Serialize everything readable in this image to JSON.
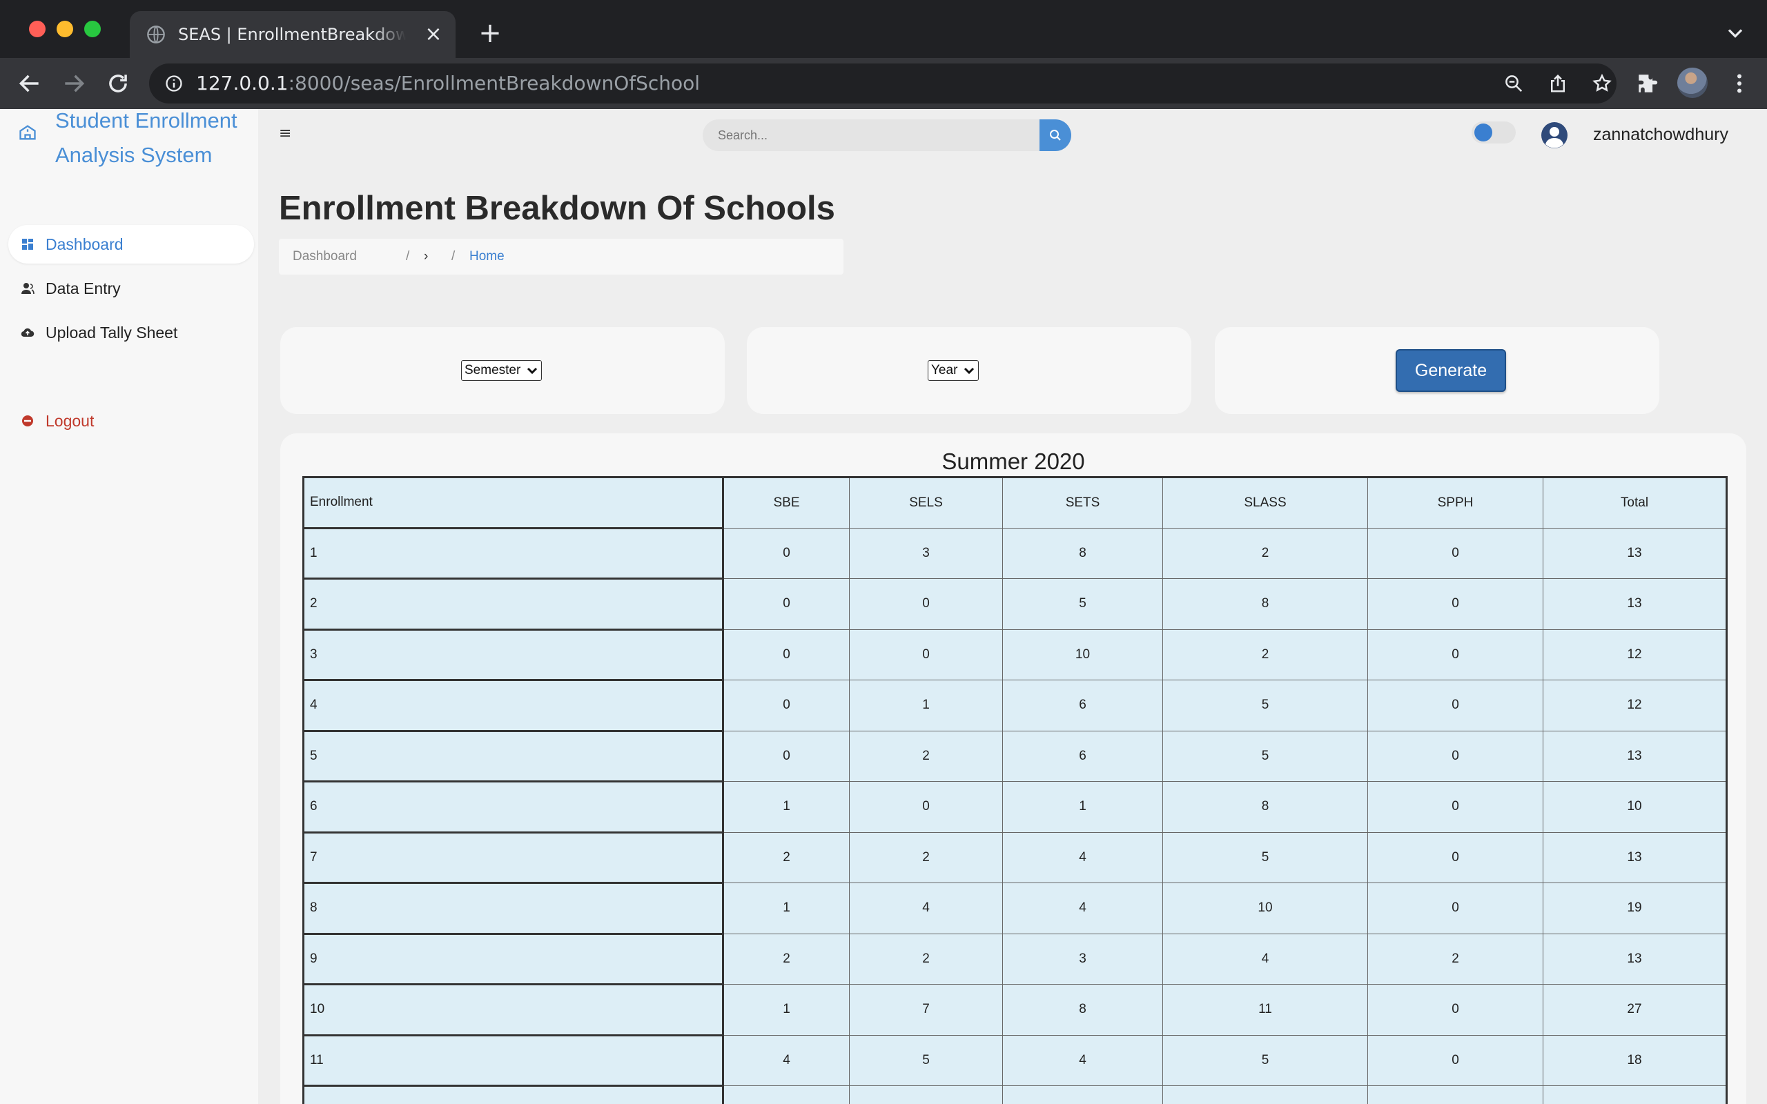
{
  "browser": {
    "tab_title": "SEAS | EnrollmentBreakdownOfSchool",
    "url_host": "127.0.0.1",
    "url_rest": ":8000/seas/EnrollmentBreakdownOfSchool"
  },
  "sidebar": {
    "brand": "Student Enrollment Analysis System",
    "items": [
      {
        "label": "Dashboard",
        "icon": "grid-icon",
        "active": true
      },
      {
        "label": "Data Entry",
        "icon": "user-icon"
      },
      {
        "label": "Upload Tally Sheet",
        "icon": "cloud-upload-icon"
      },
      {
        "label": "Logout",
        "icon": "logout-icon"
      }
    ]
  },
  "topbar": {
    "search_placeholder": "Search...",
    "username": "zannatchowdhury"
  },
  "main": {
    "title": "Enrollment Breakdown Of Schools",
    "breadcrumb": {
      "first": "Dashboard",
      "sep": "/",
      "arrow": "›",
      "last": "Home"
    },
    "filters": {
      "semester": "Semester",
      "year": "Year",
      "generate": "Generate"
    }
  },
  "table": {
    "title": "Summer 2020",
    "headers": [
      "Enrollment",
      "SBE",
      "SELS",
      "SETS",
      "SLASS",
      "SPPH",
      "Total"
    ],
    "rows": [
      [
        "1",
        "0",
        "3",
        "8",
        "2",
        "0",
        "13"
      ],
      [
        "2",
        "0",
        "0",
        "5",
        "8",
        "0",
        "13"
      ],
      [
        "3",
        "0",
        "0",
        "10",
        "2",
        "0",
        "12"
      ],
      [
        "4",
        "0",
        "1",
        "6",
        "5",
        "0",
        "12"
      ],
      [
        "5",
        "0",
        "2",
        "6",
        "5",
        "0",
        "13"
      ],
      [
        "6",
        "1",
        "0",
        "1",
        "8",
        "0",
        "10"
      ],
      [
        "7",
        "2",
        "2",
        "4",
        "5",
        "0",
        "13"
      ],
      [
        "8",
        "1",
        "4",
        "4",
        "10",
        "0",
        "19"
      ],
      [
        "9",
        "2",
        "2",
        "3",
        "4",
        "2",
        "13"
      ],
      [
        "10",
        "1",
        "7",
        "8",
        "11",
        "0",
        "27"
      ],
      [
        "11",
        "4",
        "5",
        "4",
        "5",
        "0",
        "18"
      ],
      [
        "",
        "",
        "",
        "",
        "",
        "",
        ""
      ]
    ]
  },
  "colors": {
    "accent": "#4a8fd6",
    "button": "#336db0",
    "table_bg": "#ddeef6",
    "logout": "#c0392b"
  }
}
